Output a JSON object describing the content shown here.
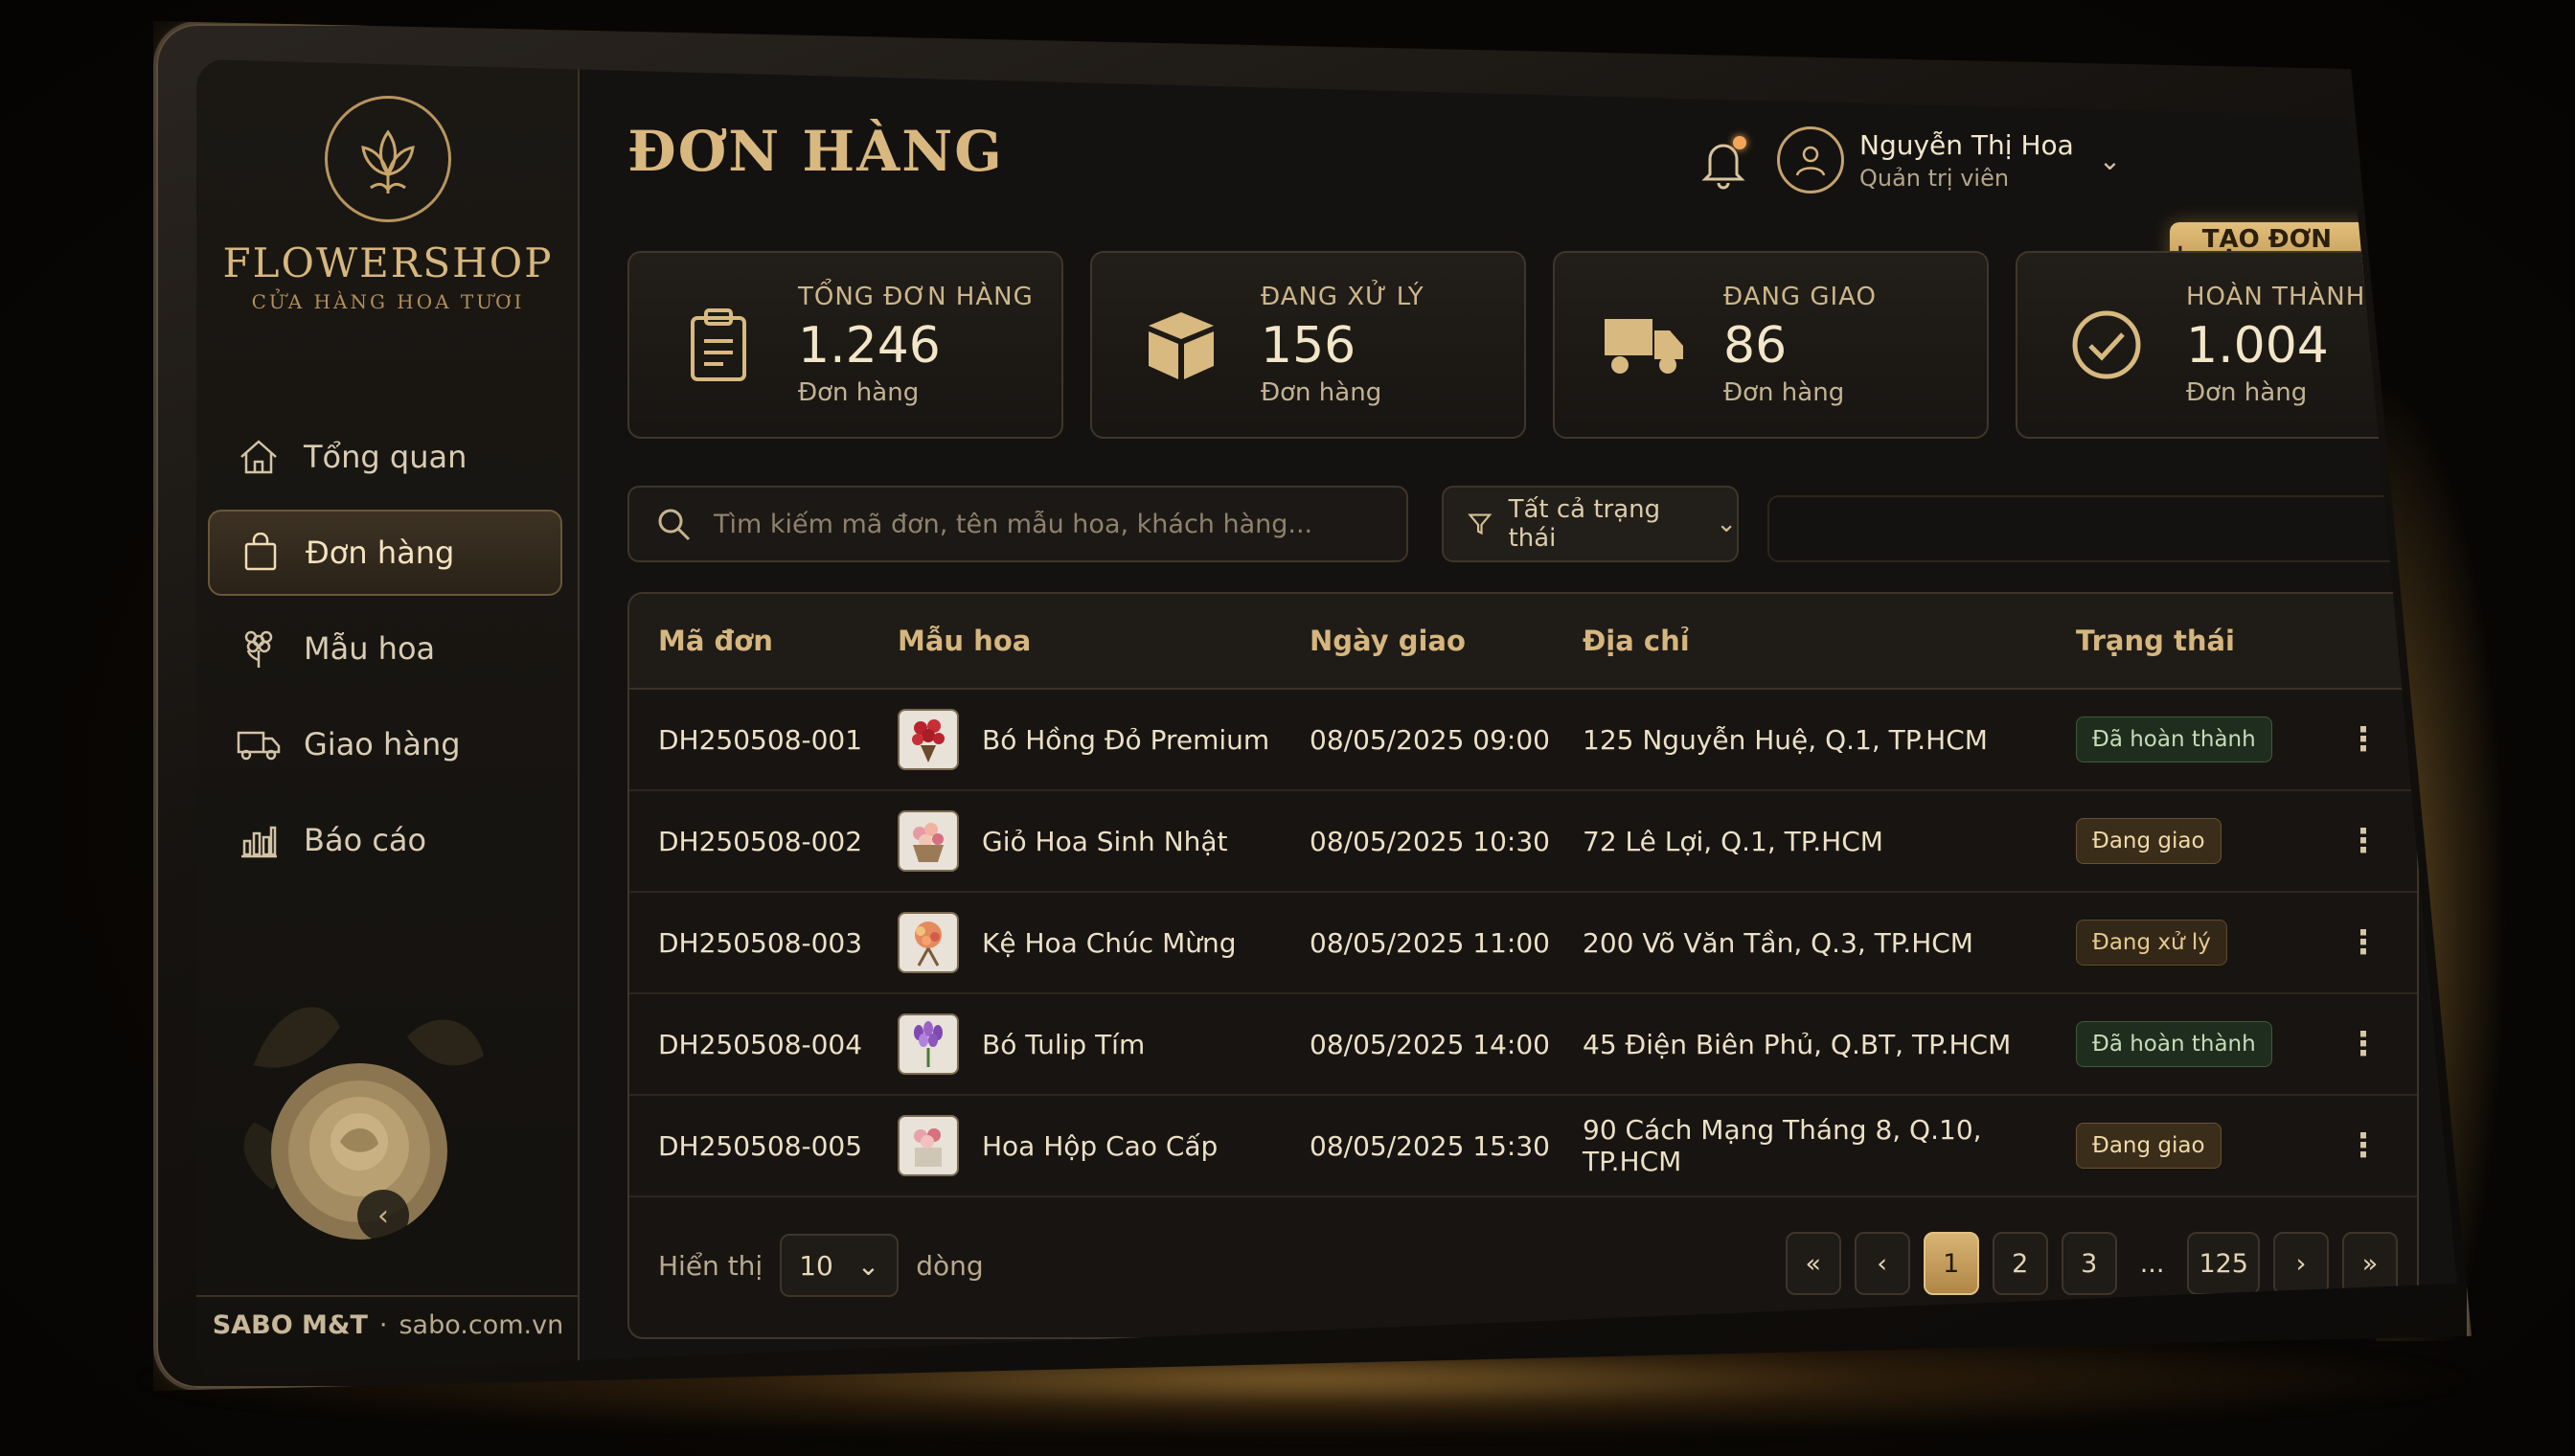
{
  "brand": {
    "name": "FLOWERSHOP",
    "tagline": "CỬA HÀNG HOA TƯƠI"
  },
  "sidebar": {
    "items": [
      {
        "label": "Tổng quan",
        "icon": "home-icon",
        "active": false
      },
      {
        "label": "Đơn hàng",
        "icon": "shopping-bag-icon",
        "active": true
      },
      {
        "label": "Mẫu hoa",
        "icon": "flower-icon",
        "active": false
      },
      {
        "label": "Giao hàng",
        "icon": "truck-icon",
        "active": false
      },
      {
        "label": "Báo cáo",
        "icon": "bar-chart-icon",
        "active": false
      }
    ],
    "collapse_icon": "chevron-left-icon",
    "footer_company": "SABO M&T",
    "footer_sep": "·",
    "footer_site": "sabo.com.vn"
  },
  "header": {
    "title": "ĐƠN HÀNG",
    "notification_icon": "bell-icon",
    "user_name": "Nguyễn Thị Hoa",
    "user_role": "Quản trị viên",
    "create_label": "TẠO ĐƠN HÀNG",
    "create_icon": "+"
  },
  "stats": [
    {
      "label": "TỔNG ĐƠN HÀNG",
      "value": "1.246",
      "unit": "Đơn hàng",
      "icon": "clipboard-icon"
    },
    {
      "label": "ĐANG XỬ LÝ",
      "value": "156",
      "unit": "Đơn hàng",
      "icon": "box-icon"
    },
    {
      "label": "ĐANG GIAO",
      "value": "86",
      "unit": "Đơn hàng",
      "icon": "truck-icon"
    },
    {
      "label": "HOÀN THÀNH",
      "value": "1.004",
      "unit": "Đơn hàng",
      "icon": "check-circle-icon"
    }
  ],
  "search": {
    "placeholder": "Tìm kiếm mã đơn, tên mẫu hoa, khách hàng..."
  },
  "filter": {
    "label": "Tất cả trạng thái"
  },
  "table": {
    "headers": [
      "Mã đơn",
      "Mẫu hoa",
      "Ngày giao",
      "Địa chỉ",
      "Trạng thái"
    ],
    "rows": [
      {
        "code": "DH250508-001",
        "flower": "Bó Hồng Đỏ Premium",
        "date": "08/05/2025 09:00",
        "address": "125 Nguyễn Huệ, Q.1, TP.HCM",
        "status": "Đã hoàn thành",
        "status_type": "done"
      },
      {
        "code": "DH250508-002",
        "flower": "Giỏ Hoa Sinh Nhật",
        "date": "08/05/2025 10:30",
        "address": "72 Lê Lợi, Q.1, TP.HCM",
        "status": "Đang giao",
        "status_type": "ship"
      },
      {
        "code": "DH250508-003",
        "flower": "Kệ Hoa Chúc Mừng",
        "date": "08/05/2025 11:00",
        "address": "200 Võ Văn Tần, Q.3, TP.HCM",
        "status": "Đang xử lý",
        "status_type": "proc"
      },
      {
        "code": "DH250508-004",
        "flower": "Bó Tulip Tím",
        "date": "08/05/2025 14:00",
        "address": "45 Điện Biên Phủ, Q.BT, TP.HCM",
        "status": "Đã hoàn thành",
        "status_type": "done"
      },
      {
        "code": "DH250508-005",
        "flower": "Hoa Hộp Cao Cấp",
        "date": "08/05/2025 15:30",
        "address": "90 Cách Mạng Tháng 8, Q.10, TP.HCM",
        "status": "Đang giao",
        "status_type": "ship"
      }
    ]
  },
  "footer": {
    "show_label": "Hiển thị",
    "page_size": "10",
    "rows_label": "dòng",
    "pages": [
      "«",
      "‹",
      "1",
      "2",
      "3",
      "...",
      "125",
      "›",
      "»"
    ],
    "current_page": "1"
  },
  "colors": {
    "accent": "#d9b87f",
    "background": "#141210",
    "done": "#c6dcb7",
    "shipping": "#f0d9a8"
  }
}
